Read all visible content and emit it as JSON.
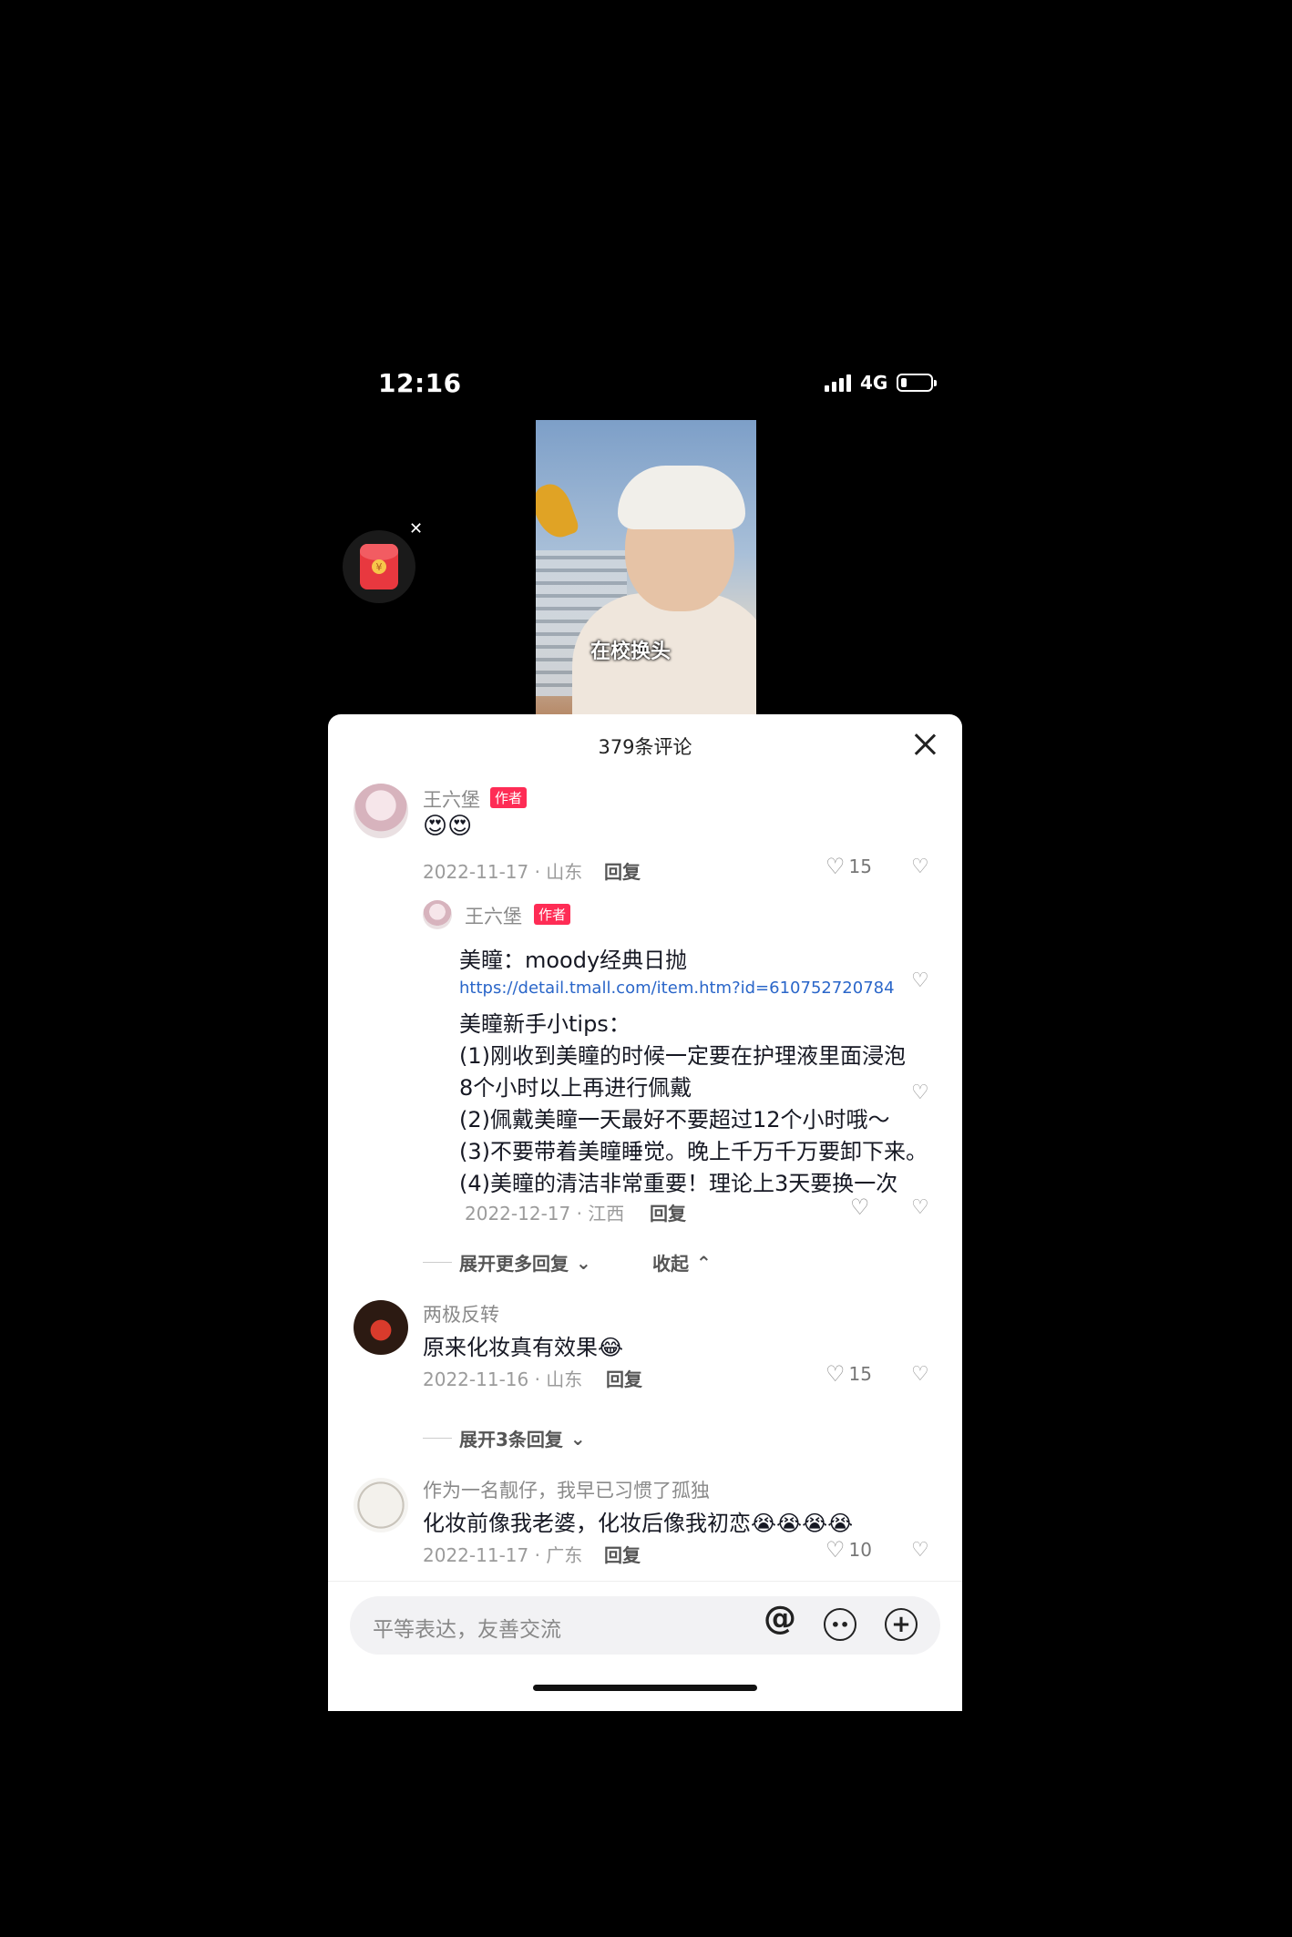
{
  "status_bar": {
    "time": "12:16",
    "network": "4G",
    "battery_level": 0.2
  },
  "video": {
    "caption": "在校换头"
  },
  "comments_sheet": {
    "title": "379条评论",
    "input_placeholder": "平等表达，友善交流",
    "comments": [
      {
        "user": "王六堡",
        "badge": "作者",
        "text": "😍😍",
        "date_loc": "2022-11-17 · 山东",
        "reply": "回复",
        "likes": "15",
        "replies": [
          {
            "user": "王六堡",
            "badge": "作者",
            "lines": [
              "美瞳：moody经典日抛",
              "https://detail.tmall.com/item.htm?id=610752720784",
              "美瞳新手小tips：",
              "(1)刚收到美瞳的时候一定要在护理液里面浸泡",
              "8个小时以上再进行佩戴",
              "(2)佩戴美瞳一天最好不要超过12个小时哦～",
              "(3)不要带着美瞳睡觉。晚上千万千万要卸下来。",
              "(4)美瞳的清洁非常重要！理论上3天要换一次"
            ],
            "date_loc": "2022-12-17 · 江西",
            "reply": "回复"
          }
        ],
        "expand_more": "展开更多回复",
        "collapse": "收起"
      },
      {
        "user": "两极反转",
        "text": "原来化妆真有效果😂",
        "date_loc": "2022-11-16 · 山东",
        "reply": "回复",
        "likes": "15",
        "expand": "展开3条回复"
      },
      {
        "user": "作为一名靓仔，我早已习惯了孤独",
        "text": "化妆前像我老婆，化妆后像我初恋😭😭😭😭",
        "date_loc": "2022-11-17 · 广东",
        "reply": "回复",
        "likes": "10"
      }
    ]
  }
}
